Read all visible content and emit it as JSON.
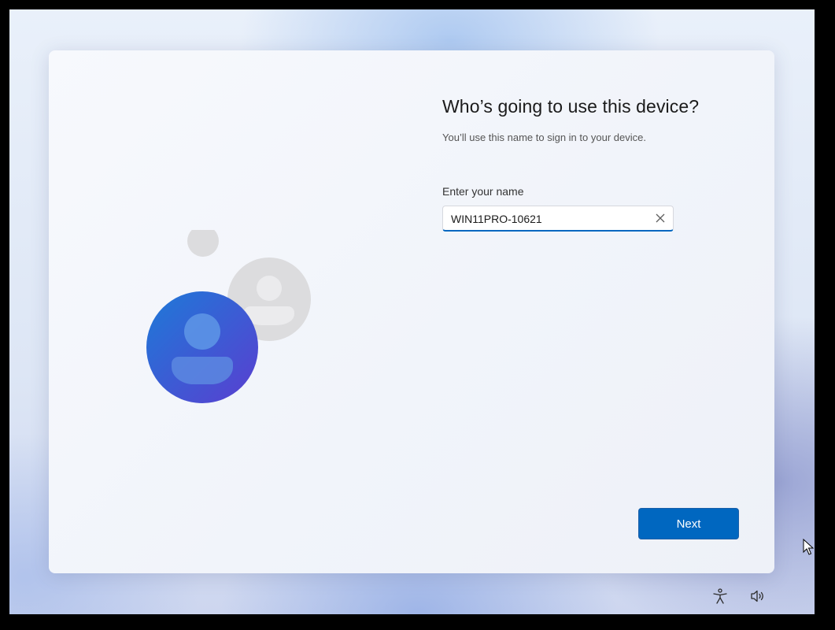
{
  "setup": {
    "title": "Who’s going to use this device?",
    "subtitle": "You’ll use this name to sign in to your device.",
    "name_label": "Enter your name",
    "name_value": "WIN11PRO-10621",
    "next_label": "Next"
  },
  "icons": {
    "illustration": "users-illustration-icon",
    "clear": "close-icon",
    "accessibility": "accessibility-icon",
    "volume": "volume-icon",
    "cursor": "mouse-pointer-icon"
  },
  "colors": {
    "accent": "#0067c0",
    "avatar_primary": "#2f5fd8",
    "avatar_secondary": "#dcdcde"
  }
}
